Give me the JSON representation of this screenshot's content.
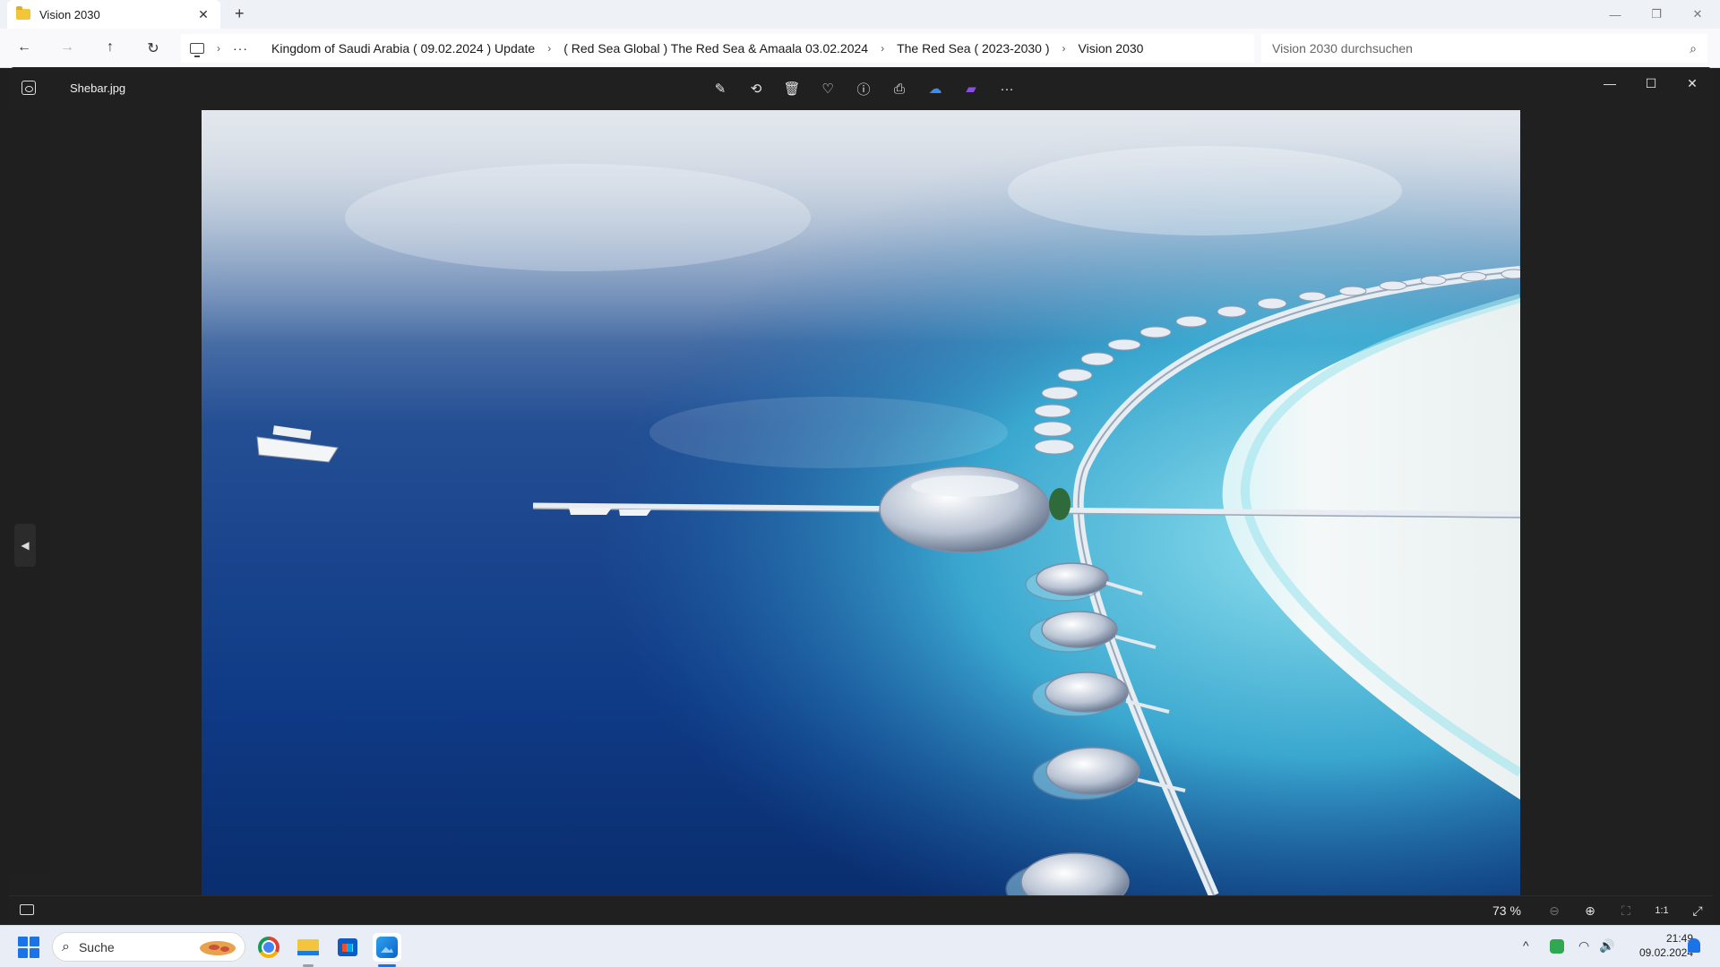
{
  "explorer": {
    "tab_title": "Vision 2030",
    "tab_close": "✕",
    "new_tab": "+",
    "window_controls": {
      "minimize": "—",
      "restore": "❐",
      "close": "✕"
    },
    "nav": {
      "back": "←",
      "forward": "→",
      "up": "↑",
      "refresh": "↻"
    },
    "breadcrumbs": [
      "Kingdom of Saudi Arabia ( 09.02.2024 ) Update",
      "( Red Sea Global ) The Red Sea & Amaala 03.02.2024",
      "The Red Sea ( 2023-2030 )",
      "Vision 2030"
    ],
    "breadcrumb_overflow": "···",
    "breadcrumb_separator": "›",
    "search_placeholder": "Vision 2030 durchsuchen",
    "search_icon": "⌕"
  },
  "viewer": {
    "file_name": "Shebar.jpg",
    "toolbar": [
      {
        "name": "edit-image",
        "glyph": "✎"
      },
      {
        "name": "rotate",
        "glyph": "⟲"
      },
      {
        "name": "delete",
        "glyph": "🗑"
      },
      {
        "name": "favorite",
        "glyph": "♡"
      },
      {
        "name": "file-info",
        "glyph": "ⓘ"
      },
      {
        "name": "print",
        "glyph": "⎙"
      },
      {
        "name": "onedrive",
        "glyph": "☁"
      },
      {
        "name": "clipchamp",
        "glyph": "▰"
      },
      {
        "name": "more",
        "glyph": "···"
      }
    ],
    "window_controls": {
      "minimize": "—",
      "maximize": "☐",
      "close": "✕"
    },
    "prev_arrow": "◀",
    "zoom": "73 %",
    "status_buttons": {
      "zoom_out": "⊖",
      "zoom_in": "⊕",
      "fit": "⛶",
      "actual_size": "1:1",
      "fullscreen": "⤢"
    },
    "colors": {
      "background": "#202020",
      "sea_deep": "#0d2f78",
      "sea_shallow": "#4fb8d6",
      "sand": "#f2f6f7"
    }
  },
  "taskbar": {
    "search_label": "Suche",
    "search_icon": "⌕",
    "apps": [
      "chrome",
      "file-explorer",
      "microsoft-store",
      "photos"
    ],
    "tray": {
      "chevron": "^",
      "wifi": "◠",
      "volume": "🔊"
    },
    "time": "21:49",
    "date": "09.02.2024"
  }
}
